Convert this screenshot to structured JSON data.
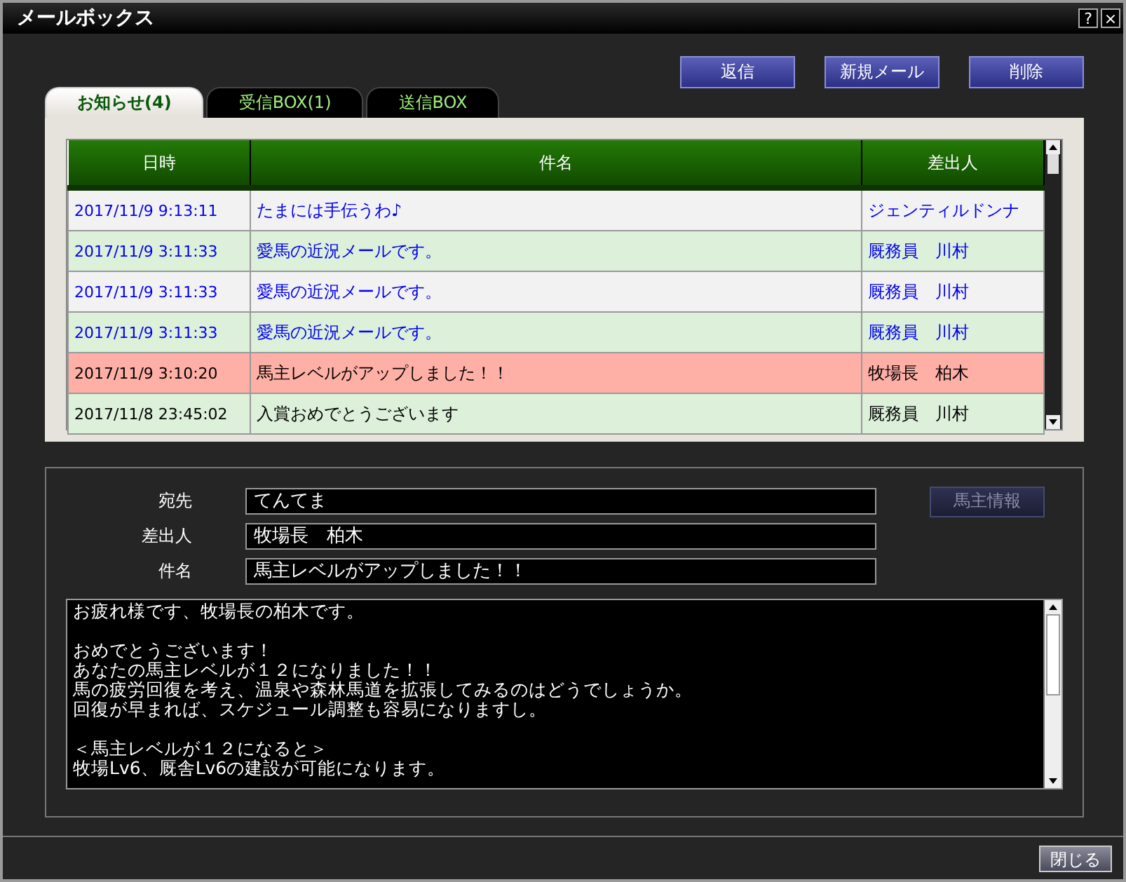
{
  "window": {
    "title": "メールボックス",
    "help": "?",
    "close": "×"
  },
  "actions": [
    {
      "label": "返信"
    },
    {
      "label": "新規メール"
    },
    {
      "label": "削除"
    }
  ],
  "tabs": [
    {
      "label": "お知らせ(4)",
      "selected": true
    },
    {
      "label": "受信BOX(1)",
      "selected": false
    },
    {
      "label": "送信BOX",
      "selected": false
    }
  ],
  "table": {
    "columns": [
      "日時",
      "件名",
      "差出人"
    ],
    "rows": [
      {
        "date": "2017/11/9 9:13:11",
        "subject": "たまには手伝うわ♪",
        "sender": "ジェンティルドンナ",
        "unread": true,
        "selected": false
      },
      {
        "date": "2017/11/9 3:11:33",
        "subject": "愛馬の近況メールです。",
        "sender": "厩務員　川村",
        "unread": true,
        "selected": false
      },
      {
        "date": "2017/11/9 3:11:33",
        "subject": "愛馬の近況メールです。",
        "sender": "厩務員　川村",
        "unread": true,
        "selected": false
      },
      {
        "date": "2017/11/9 3:11:33",
        "subject": "愛馬の近況メールです。",
        "sender": "厩務員　川村",
        "unread": true,
        "selected": false
      },
      {
        "date": "2017/11/9 3:10:20",
        "subject": "馬主レベルがアップしました！！",
        "sender": "牧場長　柏木",
        "unread": false,
        "selected": true
      },
      {
        "date": "2017/11/8 23:45:02",
        "subject": "入賞おめでとうございます",
        "sender": "厩務員　川村",
        "unread": false,
        "selected": false
      }
    ]
  },
  "detail": {
    "fields": [
      {
        "label": "宛先",
        "value": "てんてま"
      },
      {
        "label": "差出人",
        "value": "牧場長　柏木"
      },
      {
        "label": "件名",
        "value": "馬主レベルがアップしました！！"
      }
    ],
    "owner_info_button": {
      "label": "馬主情報",
      "disabled": true
    },
    "body": [
      [
        "お疲れ様です、牧場長の柏木です。"
      ],
      [
        "おめでとうございます！",
        "あなたの馬主レベルが１２になりました！！",
        "馬の疲労回復を考え、温泉や森林馬道を拡張してみるのはどうでしょうか。",
        "回復が早まれば、スケジュール調整も容易になりますし。"
      ],
      [
        "＜馬主レベルが１２になると＞",
        "牧場Lv6、厩舎Lv6の建設が可能になります。"
      ]
    ]
  },
  "footer": {
    "close_button": "閉じる"
  }
}
